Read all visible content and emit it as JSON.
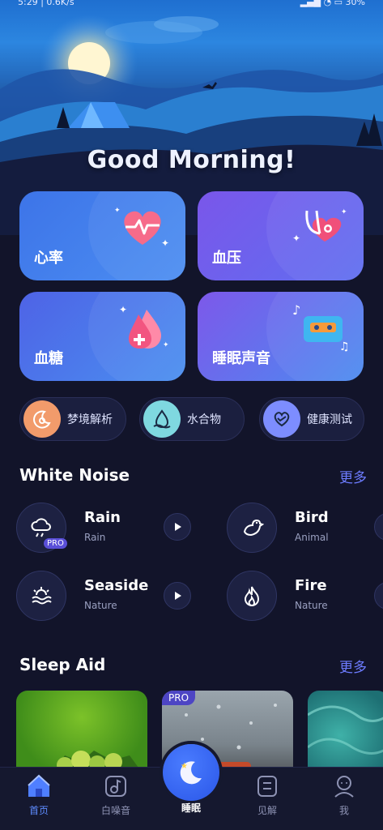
{
  "status_bar": {
    "time": "5:29 | 0.6K/s",
    "right": "▂▄▆ ◔ ▭ 30%"
  },
  "greeting": "Good Morning!",
  "cards": [
    {
      "label": "心率",
      "icon": "heart-rate-icon"
    },
    {
      "label": "血压",
      "icon": "blood-pressure-icon"
    },
    {
      "label": "血糖",
      "icon": "blood-sugar-icon"
    },
    {
      "label": "睡眠声音",
      "icon": "sleep-sound-icon"
    }
  ],
  "pills": [
    {
      "label": "梦境解析",
      "icon": "dream-icon",
      "color": "#f29b6b"
    },
    {
      "label": "水合物",
      "icon": "water-drop-icon",
      "color": "#7fd8e0"
    },
    {
      "label": "健康测试",
      "icon": "health-heart-icon",
      "color": "#7d8dff"
    }
  ],
  "white_noise": {
    "title": "White Noise",
    "more": "更多",
    "items": [
      {
        "name": "Rain",
        "sub": "Rain",
        "pro": "PRO",
        "icon": "rain-cloud-icon"
      },
      {
        "name": "Bird",
        "sub": "Animal",
        "icon": "bird-icon"
      },
      {
        "name": "Seaside",
        "sub": "Nature",
        "icon": "seaside-icon"
      },
      {
        "name": "Fire",
        "sub": "Nature",
        "icon": "fire-icon"
      }
    ]
  },
  "sleep_aid": {
    "title": "Sleep Aid",
    "more": "更多",
    "pro": "PRO"
  },
  "nav": [
    {
      "label": "首页",
      "icon": "home-icon"
    },
    {
      "label": "白噪音",
      "icon": "white-noise-icon"
    },
    {
      "label": "睡眠",
      "icon": "moon-icon"
    },
    {
      "label": "见解",
      "icon": "insight-icon"
    },
    {
      "label": "我",
      "icon": "profile-icon"
    }
  ],
  "colors": {
    "accent": "#5e8cff",
    "more_link": "#6d7cff",
    "background": "#12142a"
  }
}
